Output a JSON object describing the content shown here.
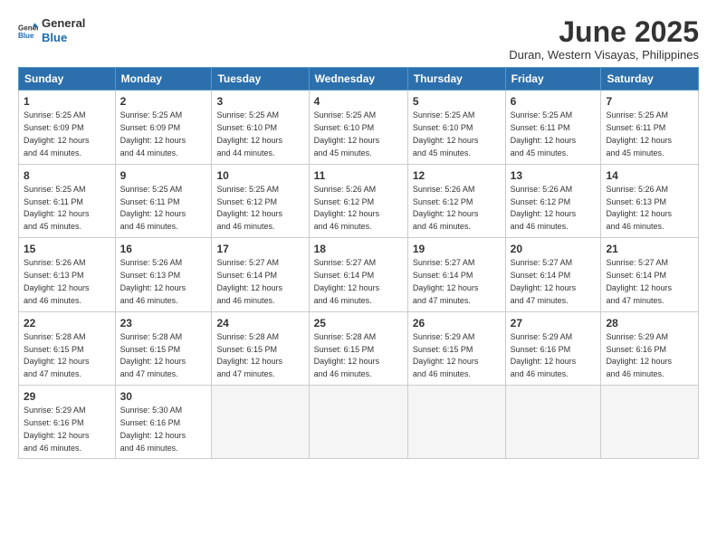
{
  "logo": {
    "line1": "General",
    "line2": "Blue"
  },
  "title": "June 2025",
  "subtitle": "Duran, Western Visayas, Philippines",
  "weekdays": [
    "Sunday",
    "Monday",
    "Tuesday",
    "Wednesday",
    "Thursday",
    "Friday",
    "Saturday"
  ],
  "weeks": [
    [
      {
        "day": "1",
        "sunrise": "5:25 AM",
        "sunset": "6:09 PM",
        "daylight": "12 hours and 44 minutes."
      },
      {
        "day": "2",
        "sunrise": "5:25 AM",
        "sunset": "6:09 PM",
        "daylight": "12 hours and 44 minutes."
      },
      {
        "day": "3",
        "sunrise": "5:25 AM",
        "sunset": "6:10 PM",
        "daylight": "12 hours and 44 minutes."
      },
      {
        "day": "4",
        "sunrise": "5:25 AM",
        "sunset": "6:10 PM",
        "daylight": "12 hours and 45 minutes."
      },
      {
        "day": "5",
        "sunrise": "5:25 AM",
        "sunset": "6:10 PM",
        "daylight": "12 hours and 45 minutes."
      },
      {
        "day": "6",
        "sunrise": "5:25 AM",
        "sunset": "6:11 PM",
        "daylight": "12 hours and 45 minutes."
      },
      {
        "day": "7",
        "sunrise": "5:25 AM",
        "sunset": "6:11 PM",
        "daylight": "12 hours and 45 minutes."
      }
    ],
    [
      {
        "day": "8",
        "sunrise": "5:25 AM",
        "sunset": "6:11 PM",
        "daylight": "12 hours and 45 minutes."
      },
      {
        "day": "9",
        "sunrise": "5:25 AM",
        "sunset": "6:11 PM",
        "daylight": "12 hours and 46 minutes."
      },
      {
        "day": "10",
        "sunrise": "5:25 AM",
        "sunset": "6:12 PM",
        "daylight": "12 hours and 46 minutes."
      },
      {
        "day": "11",
        "sunrise": "5:26 AM",
        "sunset": "6:12 PM",
        "daylight": "12 hours and 46 minutes."
      },
      {
        "day": "12",
        "sunrise": "5:26 AM",
        "sunset": "6:12 PM",
        "daylight": "12 hours and 46 minutes."
      },
      {
        "day": "13",
        "sunrise": "5:26 AM",
        "sunset": "6:12 PM",
        "daylight": "12 hours and 46 minutes."
      },
      {
        "day": "14",
        "sunrise": "5:26 AM",
        "sunset": "6:13 PM",
        "daylight": "12 hours and 46 minutes."
      }
    ],
    [
      {
        "day": "15",
        "sunrise": "5:26 AM",
        "sunset": "6:13 PM",
        "daylight": "12 hours and 46 minutes."
      },
      {
        "day": "16",
        "sunrise": "5:26 AM",
        "sunset": "6:13 PM",
        "daylight": "12 hours and 46 minutes."
      },
      {
        "day": "17",
        "sunrise": "5:27 AM",
        "sunset": "6:14 PM",
        "daylight": "12 hours and 46 minutes."
      },
      {
        "day": "18",
        "sunrise": "5:27 AM",
        "sunset": "6:14 PM",
        "daylight": "12 hours and 46 minutes."
      },
      {
        "day": "19",
        "sunrise": "5:27 AM",
        "sunset": "6:14 PM",
        "daylight": "12 hours and 47 minutes."
      },
      {
        "day": "20",
        "sunrise": "5:27 AM",
        "sunset": "6:14 PM",
        "daylight": "12 hours and 47 minutes."
      },
      {
        "day": "21",
        "sunrise": "5:27 AM",
        "sunset": "6:14 PM",
        "daylight": "12 hours and 47 minutes."
      }
    ],
    [
      {
        "day": "22",
        "sunrise": "5:28 AM",
        "sunset": "6:15 PM",
        "daylight": "12 hours and 47 minutes."
      },
      {
        "day": "23",
        "sunrise": "5:28 AM",
        "sunset": "6:15 PM",
        "daylight": "12 hours and 47 minutes."
      },
      {
        "day": "24",
        "sunrise": "5:28 AM",
        "sunset": "6:15 PM",
        "daylight": "12 hours and 47 minutes."
      },
      {
        "day": "25",
        "sunrise": "5:28 AM",
        "sunset": "6:15 PM",
        "daylight": "12 hours and 46 minutes."
      },
      {
        "day": "26",
        "sunrise": "5:29 AM",
        "sunset": "6:15 PM",
        "daylight": "12 hours and 46 minutes."
      },
      {
        "day": "27",
        "sunrise": "5:29 AM",
        "sunset": "6:16 PM",
        "daylight": "12 hours and 46 minutes."
      },
      {
        "day": "28",
        "sunrise": "5:29 AM",
        "sunset": "6:16 PM",
        "daylight": "12 hours and 46 minutes."
      }
    ],
    [
      {
        "day": "29",
        "sunrise": "5:29 AM",
        "sunset": "6:16 PM",
        "daylight": "12 hours and 46 minutes."
      },
      {
        "day": "30",
        "sunrise": "5:30 AM",
        "sunset": "6:16 PM",
        "daylight": "12 hours and 46 minutes."
      },
      null,
      null,
      null,
      null,
      null
    ]
  ],
  "labels": {
    "sunrise": "Sunrise: ",
    "sunset": "Sunset: ",
    "daylight": "Daylight: "
  }
}
